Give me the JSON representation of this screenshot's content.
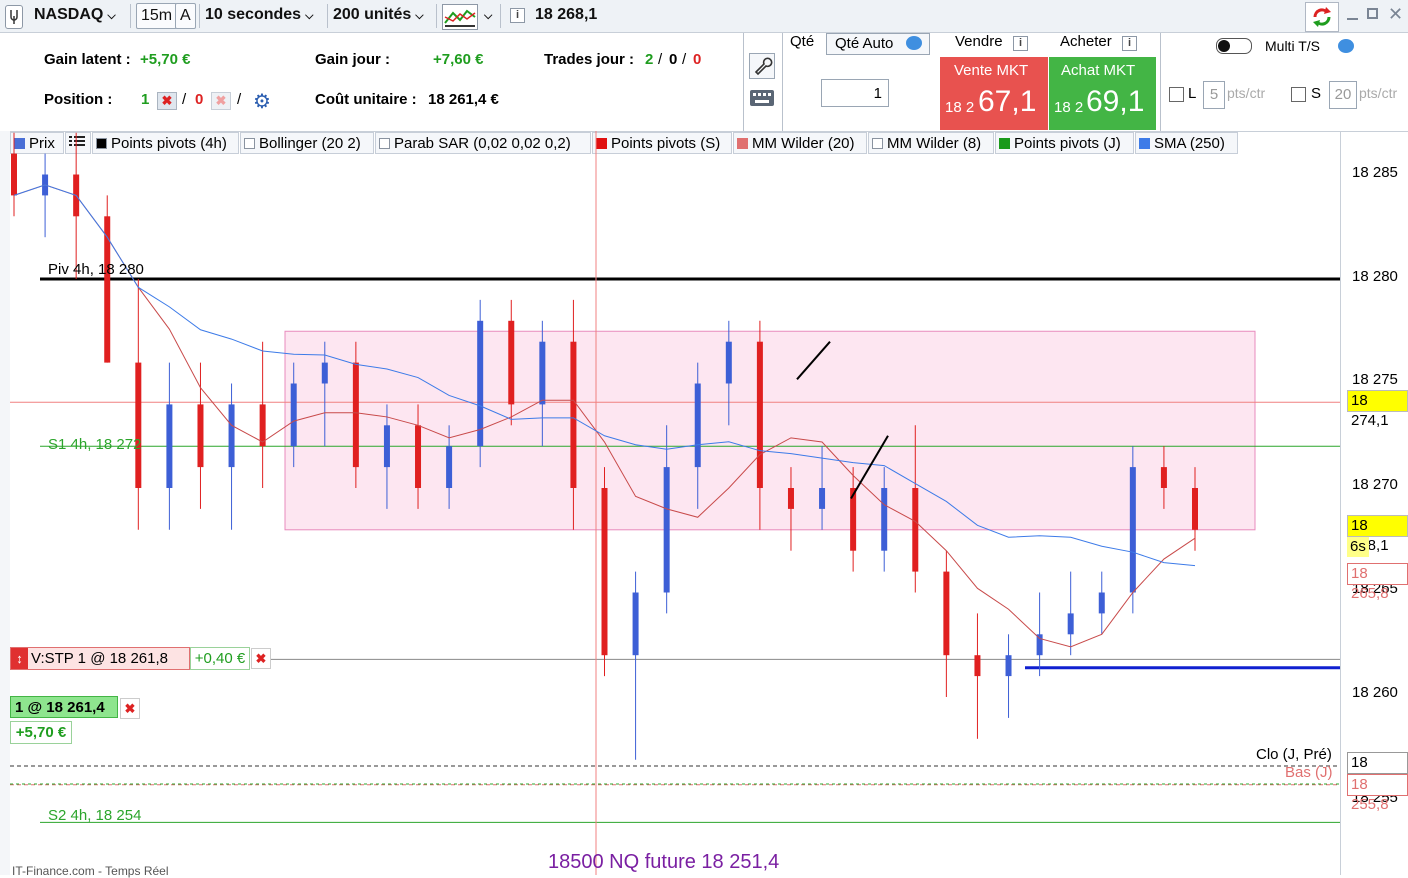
{
  "toolbar": {
    "instrument": "NASDAQ",
    "timeframe": "15m",
    "mode": "A",
    "interval": "10 secondes",
    "units": "200 unités",
    "last_price": "18 268,1"
  },
  "account": {
    "gain_latent_label": "Gain latent :",
    "gain_latent_value": "+5,70 €",
    "gain_jour_label": "Gain jour :",
    "gain_jour_value": "+7,60 €",
    "trades_jour_label": "Trades jour :",
    "trades_win": "2",
    "trades_sep1": "/",
    "trades_mid": "0",
    "trades_sep2": "/",
    "trades_loss": "0",
    "position_label": "Position :",
    "position_long": "1",
    "position_short": "0",
    "position_sep": "/",
    "position_sep2": "/",
    "cout_label": "Coût unitaire :",
    "cout_value": "18 261,4 €"
  },
  "order": {
    "qty_label": "Qté",
    "qty_auto_label": "Qté Auto",
    "qty_value": "1",
    "sell_header": "Vendre",
    "buy_header": "Acheter",
    "sell_button": "Vente MKT",
    "buy_button": "Achat MKT",
    "sell_price_prefix": "18 2",
    "sell_price_main": "67,1",
    "buy_price_prefix": "18 2",
    "buy_price_main": "69,1",
    "multi_ts": "Multi T/S",
    "l_label": "L",
    "l_value": "5",
    "l_unit": "pts/ctr",
    "s_label": "S",
    "s_value": "20",
    "s_unit": "pts/ctr"
  },
  "indicators": [
    {
      "label": "Prix",
      "color": "#4a6fd6"
    },
    {
      "label": "",
      "color": ""
    },
    {
      "label": "Points pivots (4h)",
      "color": "#000000"
    },
    {
      "label": "Bollinger (20 2)",
      "color": "#ffffff"
    },
    {
      "label": "Parab SAR (0,02 0,02 0,2)",
      "color": "#ffffff"
    },
    {
      "label": "Points pivots (S)",
      "color": "#e01010"
    },
    {
      "label": "MM Wilder (20)",
      "color": "#e07070"
    },
    {
      "label": "MM Wilder (8)",
      "color": "#ffffff"
    },
    {
      "label": "Points pivots (J)",
      "color": "#1a9a1a"
    },
    {
      "label": "SMA (250)",
      "color": "#3d7be8"
    }
  ],
  "chart_labels": {
    "piv": "Piv 4h, 18 280",
    "s1": "S1 4h, 18 272",
    "s2": "S2 4h, 18 254",
    "clo": "Clo (J, Pré)",
    "bas": "Bas (J)",
    "bottom": "18500 NQ future 18 251,4",
    "footer": "IT-Finance.com - Temps Réel"
  },
  "orders_on_chart": {
    "stop_label": "V:STP  1  @  18 261,8",
    "stop_gain": "+0,40 €",
    "pos_label": "1  @  18 261,4",
    "pos_gain": "+5,70 €"
  },
  "axis": {
    "ticks": [
      "18 285",
      "18 280",
      "18 275",
      "18 270",
      "18 265",
      "18 260",
      "18 255"
    ],
    "tag_current": "18 268,1",
    "tag_countdown": "6s",
    "tag_ref": "18 274,1",
    "tag_ma": "18 265,8",
    "tag_clo": "18 256,7",
    "tag_bas": "18 255,8"
  },
  "colors": {
    "sell": "#e8524f",
    "buy": "#43b545",
    "zone": "#fde6f1",
    "sma": "#3d7be8",
    "wilder": "#c84a4a"
  },
  "chart_data": {
    "type": "candlestick",
    "instrument": "NASDAQ",
    "ylim": [
      18251,
      18287
    ],
    "ticks": [
      18285,
      18280,
      18275,
      18270,
      18265,
      18260,
      18255
    ],
    "levels": {
      "piv_4h": 18280,
      "s1_4h": 18272,
      "s2_4h": 18254,
      "ref": 18274.1,
      "cost": 18261.4,
      "stop": 18261.8,
      "clo_j": 18256.7,
      "bas_j": 18255.8,
      "nq_future": 18251.4
    },
    "zone": {
      "from": 18268,
      "to": 18277.5
    },
    "candles": [
      {
        "o": 18286,
        "h": 18287,
        "l": 18283,
        "c": 18284
      },
      {
        "o": 18284,
        "h": 18286,
        "l": 18282,
        "c": 18285
      },
      {
        "o": 18285,
        "h": 18287,
        "l": 18280,
        "c": 18283
      },
      {
        "o": 18283,
        "h": 18284,
        "l": 18276,
        "c": 18276
      },
      {
        "o": 18276,
        "h": 18280,
        "l": 18268,
        "c": 18270
      },
      {
        "o": 18270,
        "h": 18276,
        "l": 18268,
        "c": 18274
      },
      {
        "o": 18274,
        "h": 18276,
        "l": 18269,
        "c": 18271
      },
      {
        "o": 18271,
        "h": 18275,
        "l": 18268,
        "c": 18274
      },
      {
        "o": 18274,
        "h": 18277,
        "l": 18270,
        "c": 18272
      },
      {
        "o": 18272,
        "h": 18276,
        "l": 18271,
        "c": 18275
      },
      {
        "o": 18275,
        "h": 18277,
        "l": 18272,
        "c": 18276
      },
      {
        "o": 18276,
        "h": 18277,
        "l": 18270,
        "c": 18271
      },
      {
        "o": 18271,
        "h": 18274,
        "l": 18269,
        "c": 18273
      },
      {
        "o": 18273,
        "h": 18274,
        "l": 18269,
        "c": 18270
      },
      {
        "o": 18270,
        "h": 18273,
        "l": 18269,
        "c": 18272
      },
      {
        "o": 18272,
        "h": 18279,
        "l": 18271,
        "c": 18278
      },
      {
        "o": 18278,
        "h": 18279,
        "l": 18273,
        "c": 18274
      },
      {
        "o": 18274,
        "h": 18278,
        "l": 18272,
        "c": 18277
      },
      {
        "o": 18277,
        "h": 18279,
        "l": 18268,
        "c": 18270
      },
      {
        "o": 18270,
        "h": 18271,
        "l": 18261,
        "c": 18262
      },
      {
        "o": 18262,
        "h": 18266,
        "l": 18257,
        "c": 18265
      },
      {
        "o": 18265,
        "h": 18273,
        "l": 18264,
        "c": 18271
      },
      {
        "o": 18271,
        "h": 18276,
        "l": 18269,
        "c": 18275
      },
      {
        "o": 18275,
        "h": 18278,
        "l": 18273,
        "c": 18277
      },
      {
        "o": 18277,
        "h": 18278,
        "l": 18268,
        "c": 18270
      },
      {
        "o": 18270,
        "h": 18271,
        "l": 18267,
        "c": 18269
      },
      {
        "o": 18269,
        "h": 18272,
        "l": 18268,
        "c": 18270
      },
      {
        "o": 18270,
        "h": 18271,
        "l": 18266,
        "c": 18267
      },
      {
        "o": 18267,
        "h": 18271,
        "l": 18266,
        "c": 18270
      },
      {
        "o": 18270,
        "h": 18273,
        "l": 18265,
        "c": 18266
      },
      {
        "o": 18266,
        "h": 18267,
        "l": 18260,
        "c": 18262
      },
      {
        "o": 18262,
        "h": 18264,
        "l": 18258,
        "c": 18261
      },
      {
        "o": 18261,
        "h": 18263,
        "l": 18259,
        "c": 18262
      },
      {
        "o": 18262,
        "h": 18265,
        "l": 18261,
        "c": 18263
      },
      {
        "o": 18263,
        "h": 18266,
        "l": 18262,
        "c": 18264
      },
      {
        "o": 18264,
        "h": 18266,
        "l": 18263,
        "c": 18265
      },
      {
        "o": 18265,
        "h": 18272,
        "l": 18264,
        "c": 18271
      },
      {
        "o": 18271,
        "h": 18272,
        "l": 18269,
        "c": 18270
      },
      {
        "o": 18270,
        "h": 18271,
        "l": 18267,
        "c": 18268
      }
    ]
  }
}
